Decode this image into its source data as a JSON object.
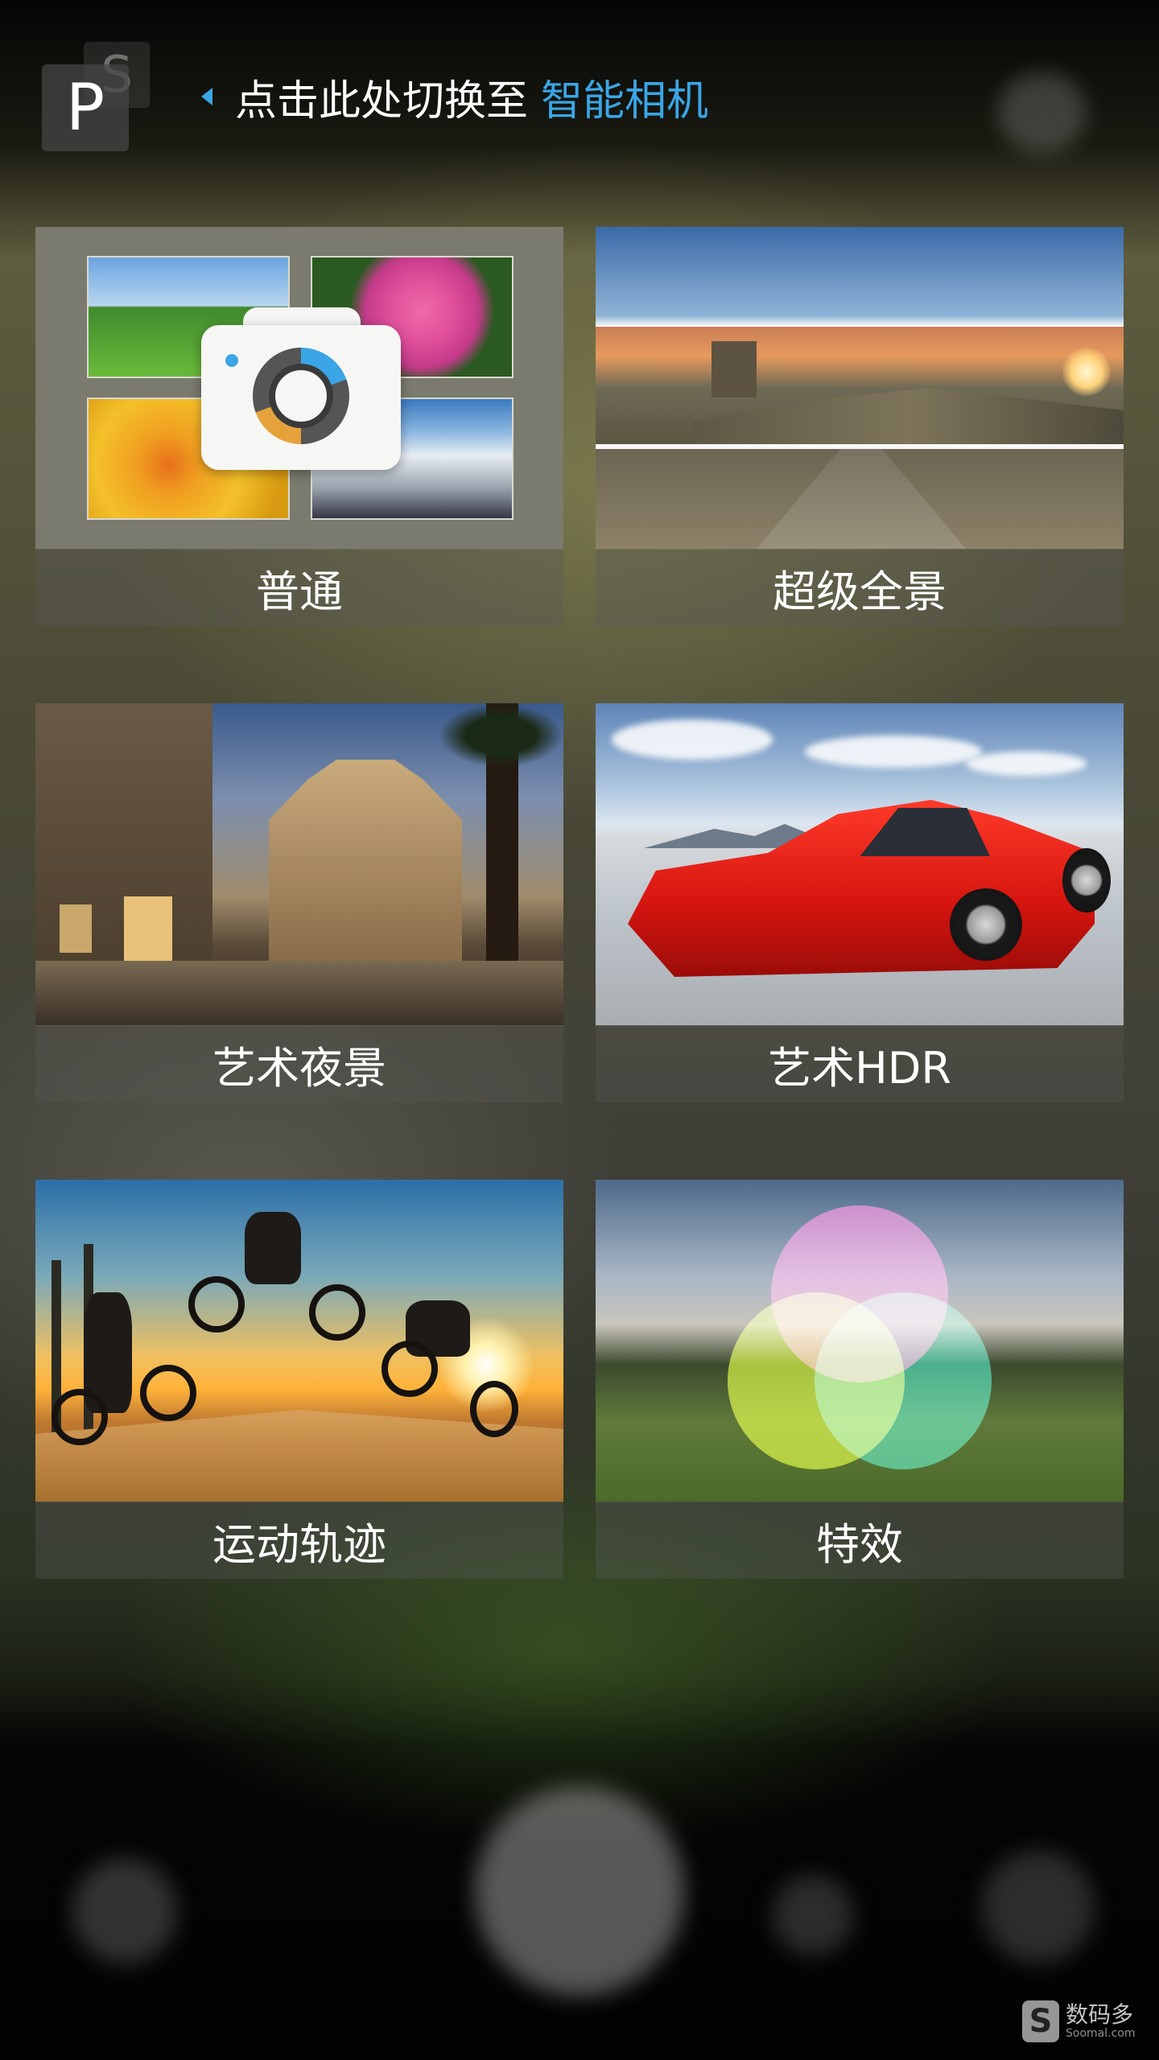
{
  "top_bar": {
    "mode_badge": "P",
    "mode_badge_back": "S",
    "switch_text": "点击此处切换至",
    "switch_link": "智能相机"
  },
  "modes": [
    {
      "label": "普通",
      "icon": "camera-icon"
    },
    {
      "label": "超级全景",
      "icon": "panorama-thumbnail"
    },
    {
      "label": "艺术夜景",
      "icon": "night-scene-thumbnail"
    },
    {
      "label": "艺术HDR",
      "icon": "hdr-car-thumbnail"
    },
    {
      "label": "运动轨迹",
      "icon": "motion-track-thumbnail"
    },
    {
      "label": "特效",
      "icon": "color-effects-thumbnail"
    }
  ],
  "watermark": {
    "logo": "S",
    "text": "数码多",
    "sub": "Soomal.com"
  },
  "colors": {
    "accent": "#3aa6e6",
    "label_text": "#ffffff"
  }
}
